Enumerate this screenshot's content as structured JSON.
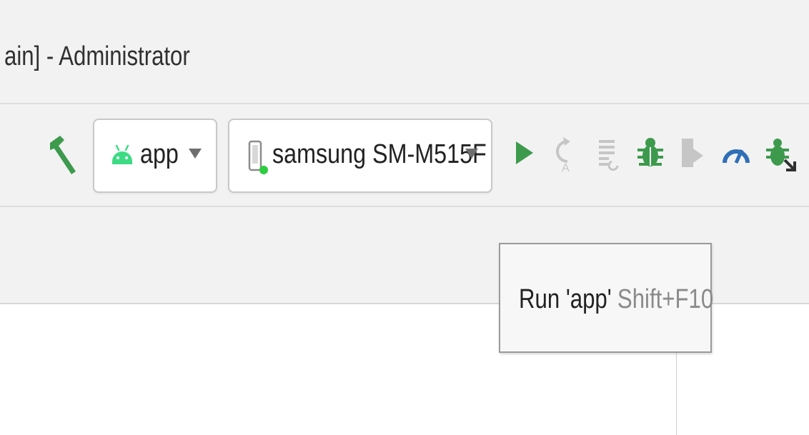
{
  "window": {
    "title": "ain] - Administrator"
  },
  "toolbar": {
    "run_config": {
      "label": "app",
      "icon": "android-icon"
    },
    "device": {
      "label": "samsung SM-M515F",
      "icon": "phone-icon",
      "status_color": "#2ecc40"
    },
    "icons": [
      "hammer-icon",
      "run-icon",
      "apply-changes-restart-icon",
      "apply-code-changes-icon",
      "debug-icon",
      "run-with-coverage-icon",
      "profiler-icon",
      "attach-debugger-icon"
    ]
  },
  "tooltip": {
    "label": "Run 'app'",
    "shortcut": "Shift+F10"
  },
  "colors": {
    "accent_green": "#3d9a4d",
    "android_green": "#3ddc84",
    "profiler_blue": "#2f6fb7",
    "background": "#f2f2f2"
  }
}
